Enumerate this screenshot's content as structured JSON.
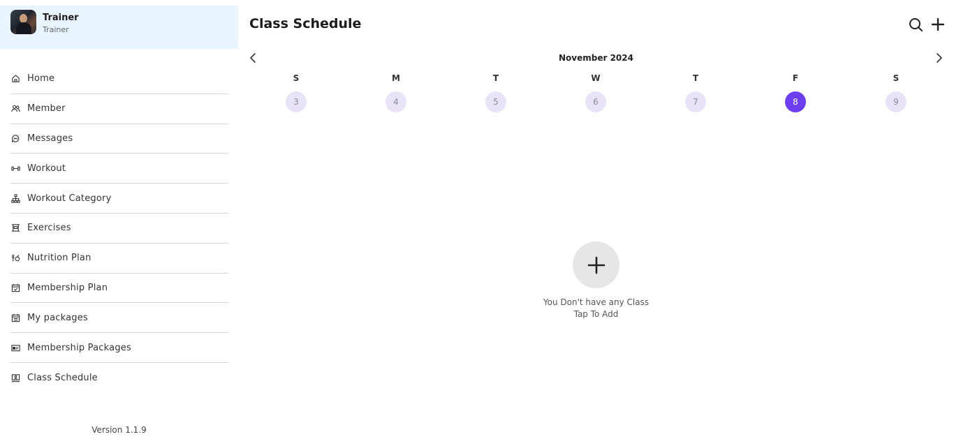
{
  "sidebar": {
    "profile": {
      "name": "Trainer",
      "role": "Trainer"
    },
    "items": [
      {
        "label": "Home",
        "icon": "home-icon"
      },
      {
        "label": "Member",
        "icon": "users-icon"
      },
      {
        "label": "Messages",
        "icon": "chat-icon"
      },
      {
        "label": "Workout",
        "icon": "dumbbell-icon"
      },
      {
        "label": "Workout Category",
        "icon": "hierarchy-icon"
      },
      {
        "label": "Exercises",
        "icon": "exercise-icon"
      },
      {
        "label": "Nutrition Plan",
        "icon": "nutrition-icon"
      },
      {
        "label": "Membership Plan",
        "icon": "calendar-check-icon"
      },
      {
        "label": "My packages",
        "icon": "calendar-list-icon"
      },
      {
        "label": "Membership Packages",
        "icon": "card-icon"
      },
      {
        "label": "Class Schedule",
        "icon": "board-icon"
      }
    ],
    "version": "Version 1.1.9"
  },
  "header": {
    "title": "Class Schedule",
    "search_icon": "search-icon",
    "add_icon": "plus-icon"
  },
  "calendar": {
    "month": "November 2024",
    "days": [
      {
        "letter": "S",
        "num": "3"
      },
      {
        "letter": "M",
        "num": "4"
      },
      {
        "letter": "T",
        "num": "5"
      },
      {
        "letter": "W",
        "num": "6"
      },
      {
        "letter": "T",
        "num": "7"
      },
      {
        "letter": "F",
        "num": "8",
        "selected": true
      },
      {
        "letter": "S",
        "num": "9"
      }
    ],
    "selected_color": "#6c3ef0",
    "day_bg_color": "#e8e3f6"
  },
  "empty_state": {
    "line1": "You Don't have any Class",
    "line2": "Tap To Add"
  },
  "colors": {
    "profile_bg": "#e9f5fe",
    "accent": "#6c3ef0"
  }
}
